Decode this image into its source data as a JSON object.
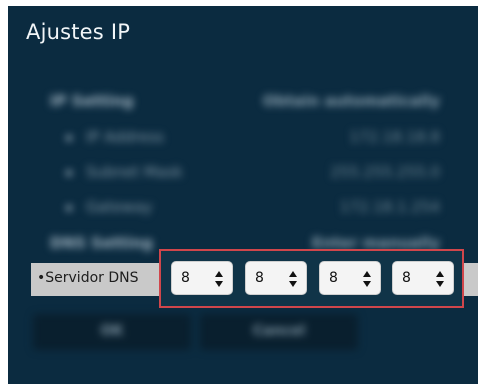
{
  "title": "Ajustes IP",
  "settings_blurred": {
    "ip_setting": {
      "label": "IP Setting",
      "value": "Obtain automatically"
    },
    "ip_address": {
      "label": "IP Address",
      "value": "172.18.18.8"
    },
    "subnet_mask": {
      "label": "Subnet Mask",
      "value": "255.255.255.0"
    },
    "gateway": {
      "label": "Gateway",
      "value": "172.18.1.254"
    },
    "dns_setting": {
      "label": "DNS Setting",
      "value": "Enter manually"
    }
  },
  "dns": {
    "label": "•Servidor DNS",
    "octets": [
      "8",
      "8",
      "8",
      "8"
    ]
  },
  "buttons": {
    "ok": "OK",
    "cancel": "Cancel"
  },
  "colors": {
    "panel_bg": "#0b2b40",
    "highlight_border": "#d0464b",
    "dns_strip": "#c9c9c9"
  }
}
